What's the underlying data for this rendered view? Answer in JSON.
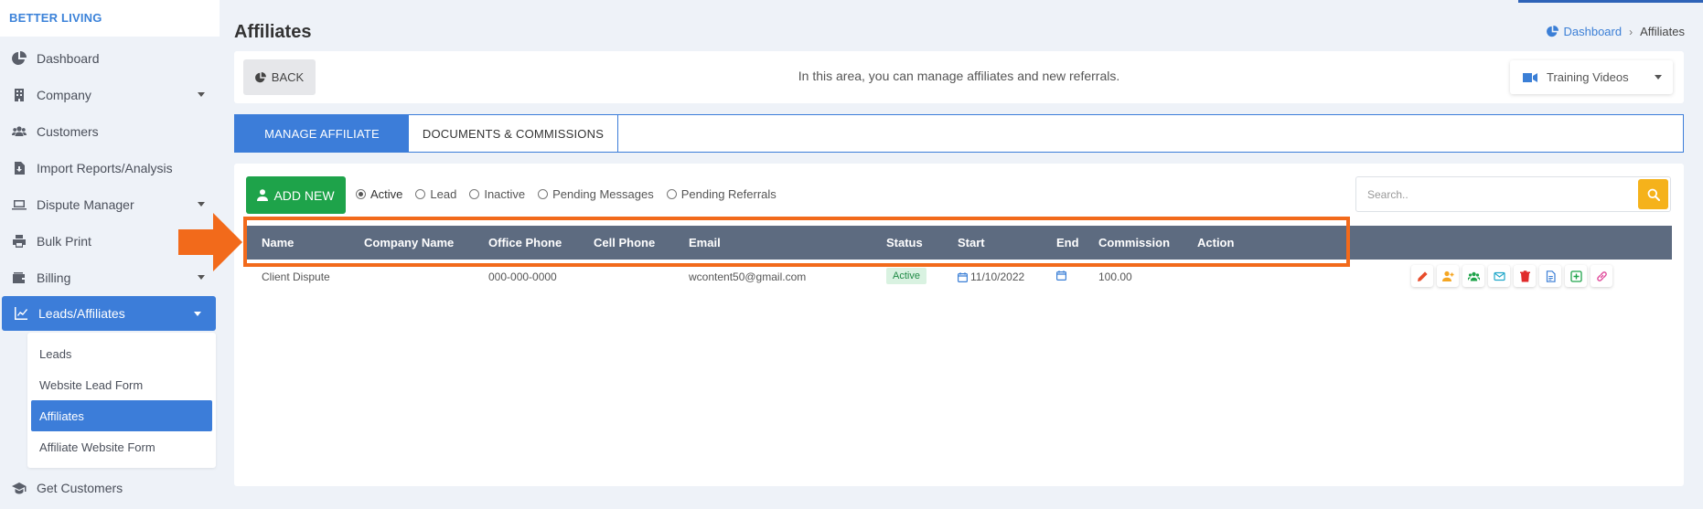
{
  "app": {
    "brand": "BETTER LIVING"
  },
  "sidebar": {
    "items": [
      {
        "label": "Dashboard",
        "icon": "pie-chart-icon"
      },
      {
        "label": "Company",
        "icon": "building-icon"
      },
      {
        "label": "Customers",
        "icon": "users-icon"
      },
      {
        "label": "Import Reports/Analysis",
        "icon": "file-import-icon"
      },
      {
        "label": "Dispute Manager",
        "icon": "laptop-icon"
      },
      {
        "label": "Bulk Print",
        "icon": "printer-icon"
      },
      {
        "label": "Billing",
        "icon": "wallet-icon"
      },
      {
        "label": "Leads/Affiliates",
        "icon": "chart-line-icon"
      },
      {
        "label": "Get Customers",
        "icon": "graduation-cap-icon"
      }
    ],
    "submenu": [
      "Leads",
      "Website Lead Form",
      "Affiliates",
      "Affiliate Website Form"
    ]
  },
  "page": {
    "title": "Affiliates",
    "breadcrumb": {
      "home": "Dashboard",
      "current": "Affiliates"
    }
  },
  "bar": {
    "back_label": "BACK",
    "message": "In this area, you can manage affiliates and new referrals.",
    "training_label": "Training Videos"
  },
  "tabs": [
    "MANAGE AFFILIATE",
    "DOCUMENTS & COMMISSIONS"
  ],
  "toolbar": {
    "add_label": "ADD NEW",
    "filters": [
      "Active",
      "Lead",
      "Inactive",
      "Pending Messages",
      "Pending Referrals"
    ],
    "selected_filter": "Active",
    "search_placeholder": "Search.."
  },
  "table": {
    "columns": [
      "Name",
      "Company Name",
      "Office Phone",
      "Cell Phone",
      "Email",
      "Status",
      "Start",
      "End",
      "Commission",
      "Action"
    ],
    "rows": [
      {
        "name": "Client Dispute",
        "company": "",
        "office_phone": "000-000-0000",
        "cell_phone": "",
        "email": "wcontent50@gmail.com",
        "status": "Active",
        "start": "11/10/2022",
        "end": "",
        "commission": "100.00"
      }
    ]
  },
  "colors": {
    "primary": "#3c7dd9",
    "add_button": "#1ea34a",
    "search_button": "#f5b21b",
    "table_header": "#5d6b80",
    "highlight": "#f26a1b"
  }
}
